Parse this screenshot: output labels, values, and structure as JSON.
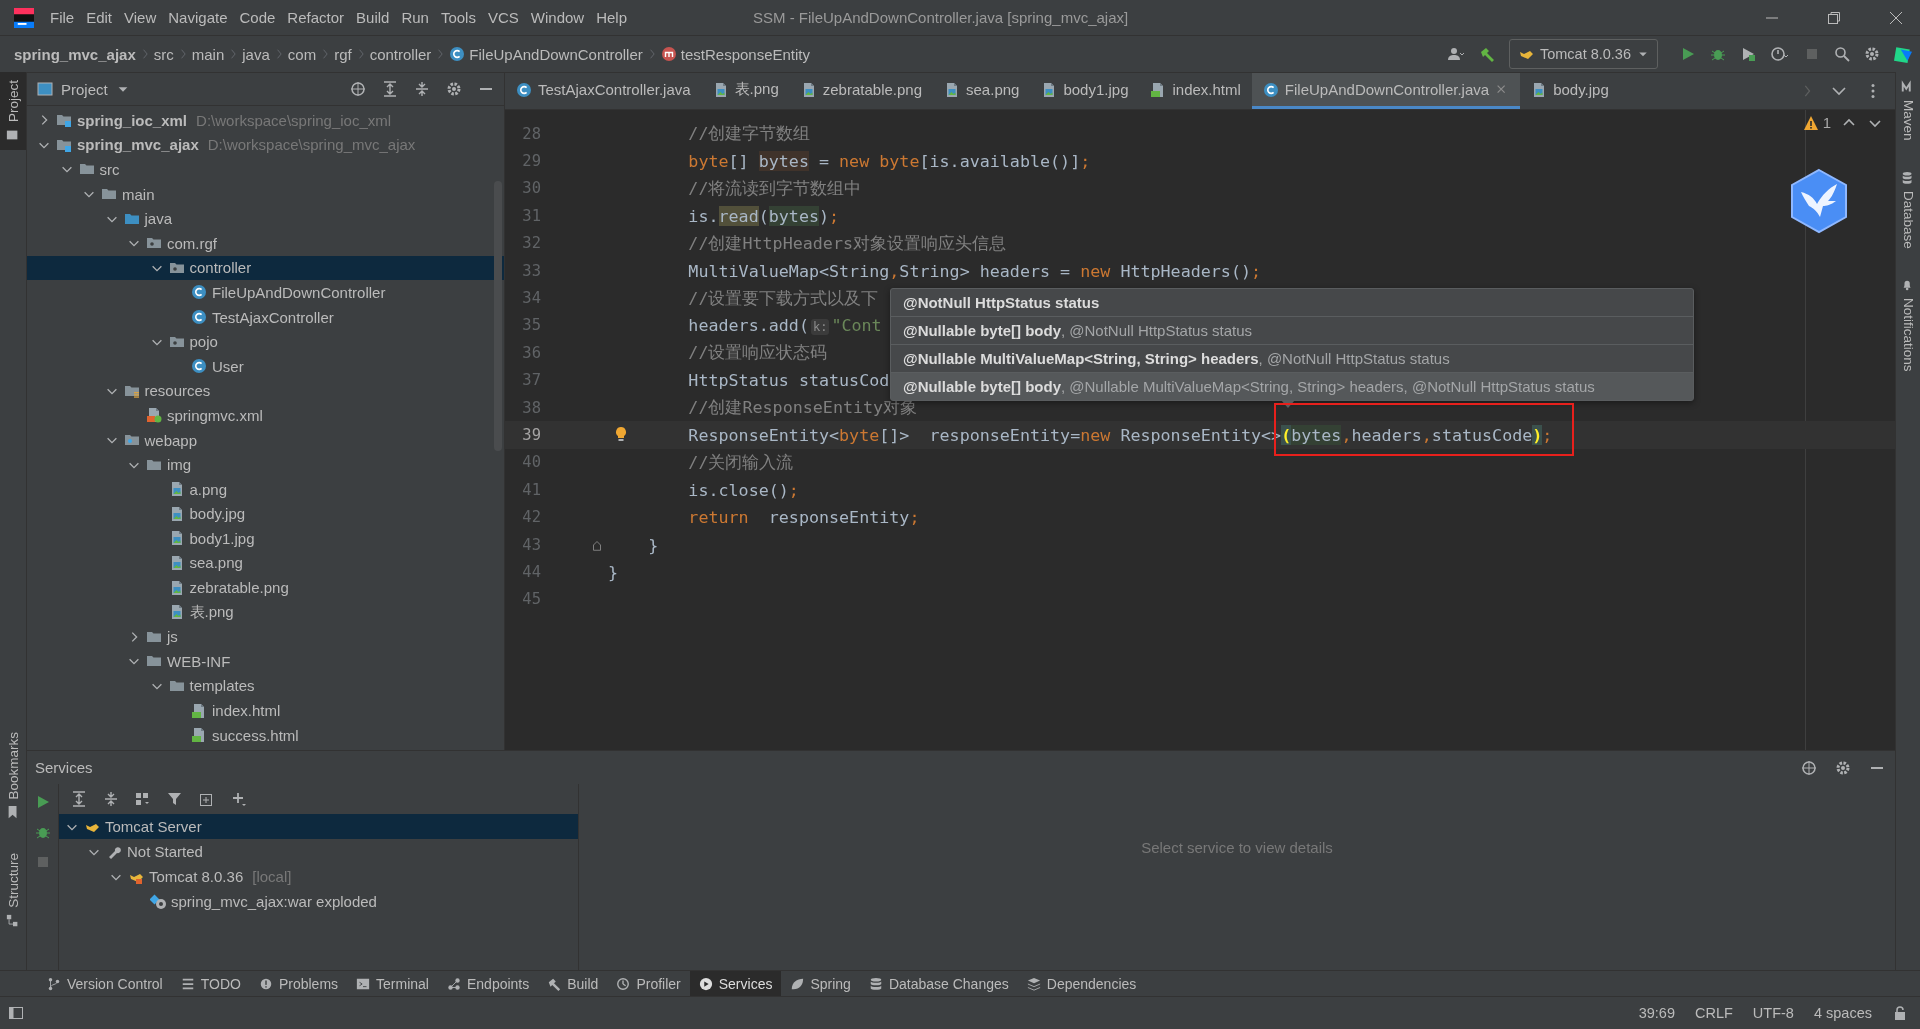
{
  "window": {
    "title": "SSM - FileUpAndDownController.java [spring_mvc_ajax]"
  },
  "menu": [
    "File",
    "Edit",
    "View",
    "Navigate",
    "Code",
    "Refactor",
    "Build",
    "Run",
    "Tools",
    "VCS",
    "Window",
    "Help"
  ],
  "navigation_bar": {
    "breadcrumbs": [
      {
        "label": "spring_mvc_ajax",
        "kind": "project"
      },
      {
        "label": "src",
        "kind": "dir"
      },
      {
        "label": "main",
        "kind": "dir"
      },
      {
        "label": "java",
        "kind": "dir"
      },
      {
        "label": "com",
        "kind": "dir"
      },
      {
        "label": "rgf",
        "kind": "dir"
      },
      {
        "label": "controller",
        "kind": "dir"
      },
      {
        "label": "FileUpAndDownController",
        "kind": "class"
      },
      {
        "label": "testResponseEntity",
        "kind": "method"
      }
    ],
    "run_configuration": "Tomcat 8.0.36"
  },
  "left_stripe": {
    "top": [
      {
        "label": "Project",
        "kind": "project",
        "selected": true
      }
    ],
    "bottom": [
      {
        "label": "Bookmarks",
        "kind": "bookmark",
        "selected": false
      },
      {
        "label": "Structure",
        "kind": "structure",
        "selected": false
      }
    ]
  },
  "project_panel": {
    "title": "Project",
    "tree": [
      {
        "label": "spring_ioc_xml",
        "hint": "D:\\workspace\\spring_ioc_xml",
        "kind": "module",
        "expanded": false,
        "selected": false
      },
      {
        "label": "spring_mvc_ajax",
        "hint": "D:\\workspace\\spring_mvc_ajax",
        "kind": "module",
        "expanded": true,
        "selected": false,
        "children": [
          {
            "label": "src",
            "kind": "folder",
            "expanded": true,
            "selected": false,
            "children": [
              {
                "label": "main",
                "kind": "folder",
                "expanded": true,
                "selected": false,
                "children": [
                  {
                    "label": "java",
                    "kind": "source",
                    "expanded": true,
                    "selected": false,
                    "children": [
                      {
                        "label": "com.rgf",
                        "kind": "package",
                        "expanded": true,
                        "selected": false,
                        "children": [
                          {
                            "label": "controller",
                            "kind": "package",
                            "expanded": true,
                            "selected": true,
                            "children": [
                              {
                                "label": "FileUpAndDownController",
                                "kind": "class",
                                "selected": false
                              },
                              {
                                "label": "TestAjaxController",
                                "kind": "class",
                                "selected": false
                              }
                            ]
                          },
                          {
                            "label": "pojo",
                            "kind": "package",
                            "expanded": true,
                            "selected": false,
                            "children": [
                              {
                                "label": "User",
                                "kind": "class",
                                "selected": false
                              }
                            ]
                          }
                        ]
                      }
                    ]
                  },
                  {
                    "label": "resources",
                    "kind": "resources",
                    "expanded": true,
                    "selected": false,
                    "children": [
                      {
                        "label": "springmvc.xml",
                        "kind": "spring_xml",
                        "selected": false
                      }
                    ]
                  },
                  {
                    "label": "webapp",
                    "kind": "web",
                    "expanded": true,
                    "selected": false,
                    "children": [
                      {
                        "label": "img",
                        "kind": "folder",
                        "expanded": true,
                        "selected": false,
                        "children": [
                          {
                            "label": "a.png",
                            "kind": "image",
                            "selected": false
                          },
                          {
                            "label": "body.jpg",
                            "kind": "image",
                            "selected": false
                          },
                          {
                            "label": "body1.jpg",
                            "kind": "image",
                            "selected": false
                          },
                          {
                            "label": "sea.png",
                            "kind": "image",
                            "selected": false
                          },
                          {
                            "label": "zebratable.png",
                            "kind": "image",
                            "selected": false
                          },
                          {
                            "label": "表.png",
                            "kind": "image",
                            "selected": false
                          }
                        ]
                      },
                      {
                        "label": "js",
                        "kind": "folder",
                        "expanded": false,
                        "selected": false
                      },
                      {
                        "label": "WEB-INF",
                        "kind": "folder",
                        "expanded": true,
                        "selected": false,
                        "children": [
                          {
                            "label": "templates",
                            "kind": "folder",
                            "expanded": true,
                            "selected": false,
                            "children": [
                              {
                                "label": "index.html",
                                "kind": "html",
                                "selected": false
                              },
                              {
                                "label": "success.html",
                                "kind": "html",
                                "selected": false
                              }
                            ]
                          }
                        ]
                      }
                    ]
                  }
                ]
              }
            ]
          }
        ]
      }
    ]
  },
  "editor": {
    "tabs": [
      {
        "label": "TestAjaxController.java",
        "kind": "class",
        "selected": false
      },
      {
        "label": "表.png",
        "kind": "image",
        "selected": false
      },
      {
        "label": "zebratable.png",
        "kind": "image",
        "selected": false
      },
      {
        "label": "sea.png",
        "kind": "image",
        "selected": false
      },
      {
        "label": "body1.jpg",
        "kind": "image",
        "selected": false
      },
      {
        "label": "index.html",
        "kind": "html",
        "selected": false
      },
      {
        "label": "FileUpAndDownController.java",
        "kind": "class",
        "selected": true
      },
      {
        "label": "body.jpg",
        "kind": "image",
        "selected": false
      }
    ],
    "warning_count": "1",
    "lines": [
      {
        "number": "28",
        "tokens": [
          {
            "text": "        //创建字节数组",
            "kind": "comment"
          }
        ]
      },
      {
        "number": "29",
        "tokens": [
          {
            "text": "        byte",
            "kind": "keyword"
          },
          {
            "text": "[] ",
            "kind": "plain"
          },
          {
            "text": "bytes",
            "kind": "write_usage"
          },
          {
            "text": " = ",
            "kind": "plain"
          },
          {
            "text": "new byte",
            "kind": "keyword"
          },
          {
            "text": "[is.available()]",
            "kind": "plain"
          },
          {
            "text": ";",
            "kind": "keyword"
          }
        ]
      },
      {
        "number": "30",
        "tokens": [
          {
            "text": "        //将流读到字节数组中",
            "kind": "comment"
          }
        ]
      },
      {
        "number": "31",
        "tokens": [
          {
            "text": "        is.",
            "kind": "plain"
          },
          {
            "text": "read",
            "kind": "usage"
          },
          {
            "text": "(",
            "kind": "plain"
          },
          {
            "text": "bytes",
            "kind": "read_usage"
          },
          {
            "text": ")",
            "kind": "plain"
          },
          {
            "text": ";",
            "kind": "keyword"
          }
        ]
      },
      {
        "number": "32",
        "tokens": [
          {
            "text": "        //创建HttpHeaders对象设置响应头信息",
            "kind": "comment"
          }
        ]
      },
      {
        "number": "33",
        "tokens": [
          {
            "text": "        MultiValueMap<String",
            "kind": "plain"
          },
          {
            "text": ",",
            "kind": "keyword"
          },
          {
            "text": "String> headers = ",
            "kind": "plain"
          },
          {
            "text": "new",
            "kind": "keyword"
          },
          {
            "text": " HttpHeaders()",
            "kind": "plain"
          },
          {
            "text": ";",
            "kind": "keyword"
          }
        ]
      },
      {
        "number": "34",
        "tokens": [
          {
            "text": "        //设置要下载方式以及下",
            "kind": "comment"
          }
        ]
      },
      {
        "number": "35",
        "tokens": [
          {
            "text": "        headers.add(",
            "kind": "plain"
          },
          {
            "text": "k:",
            "kind": "hint"
          },
          {
            "text": "\"Cont",
            "kind": "string"
          }
        ]
      },
      {
        "number": "36",
        "tokens": [
          {
            "text": "        //设置响应状态码",
            "kind": "comment"
          }
        ]
      },
      {
        "number": "37",
        "tokens": [
          {
            "text": "        HttpStatus statusCod",
            "kind": "plain"
          }
        ]
      },
      {
        "number": "38",
        "tokens": [
          {
            "text": "        //创建ResponseEntity对象",
            "kind": "comment"
          }
        ]
      },
      {
        "number": "39",
        "current": true,
        "bulb": true,
        "tokens": [
          {
            "text": "        ResponseEntity<",
            "kind": "plain"
          },
          {
            "text": "byte",
            "kind": "keyword"
          },
          {
            "text": "[]>  responseEntity=",
            "kind": "plain"
          },
          {
            "text": "new",
            "kind": "keyword"
          },
          {
            "text": " ResponseEntity<>",
            "kind": "plain"
          },
          {
            "text": "(",
            "kind": "brace_match"
          },
          {
            "text": "bytes",
            "kind": "read_usage"
          },
          {
            "text": ",",
            "kind": "keyword"
          },
          {
            "text": "headers",
            "kind": "plain"
          },
          {
            "text": ",",
            "kind": "keyword"
          },
          {
            "text": "statusCode",
            "kind": "plain"
          },
          {
            "text": ")",
            "kind": "brace_match"
          },
          {
            "text": ";",
            "kind": "keyword"
          }
        ]
      },
      {
        "number": "40",
        "tokens": [
          {
            "text": "        //关闭输入流",
            "kind": "comment"
          }
        ]
      },
      {
        "number": "41",
        "tokens": [
          {
            "text": "        is.close()",
            "kind": "plain"
          },
          {
            "text": ";",
            "kind": "keyword"
          }
        ]
      },
      {
        "number": "42",
        "tokens": [
          {
            "text": "        return",
            "kind": "keyword"
          },
          {
            "text": "  responseEntity",
            "kind": "plain"
          },
          {
            "text": ";",
            "kind": "keyword"
          }
        ]
      },
      {
        "number": "43",
        "fold": true,
        "tokens": [
          {
            "text": "    }",
            "kind": "plain"
          }
        ]
      },
      {
        "number": "44",
        "tokens": [
          {
            "text": "}",
            "kind": "plain"
          }
        ]
      },
      {
        "number": "45"
      }
    ],
    "parameter_info": [
      {
        "bold": "@NotNull HttpStatus status",
        "selected": false
      },
      {
        "bold": "@Nullable byte[] body",
        "rest": ", @NotNull HttpStatus status",
        "selected": false
      },
      {
        "bold": "@Nullable MultiValueMap<String, String> headers",
        "rest": ", @NotNull HttpStatus status",
        "selected": false
      },
      {
        "bold": "@Nullable byte[] body",
        "rest": ", @Nullable MultiValueMap<String, String> headers, @NotNull HttpStatus status",
        "selected": true
      }
    ]
  },
  "right_stripe": [
    {
      "label": "Maven",
      "kind": "maven"
    },
    {
      "label": "Database",
      "kind": "database"
    },
    {
      "label": "Notifications",
      "kind": "bell"
    }
  ],
  "services": {
    "title": "Services",
    "tree": [
      {
        "label": "Tomcat Server",
        "kind": "tomcat",
        "expanded": true,
        "selected": true,
        "children": [
          {
            "label": "Not Started",
            "kind": "wrench",
            "expanded": true,
            "selected": false,
            "children": [
              {
                "label": "Tomcat 8.0.36",
                "hint": "[local]",
                "kind": "tomcat_local",
                "expanded": true,
                "selected": false,
                "children": [
                  {
                    "label": "spring_mvc_ajax:war exploded",
                    "kind": "artifact",
                    "selected": false
                  }
                ]
              }
            ]
          }
        ]
      }
    ],
    "empty_text": "Select service to view details"
  },
  "tool_tabs": [
    {
      "label": "Version Control",
      "kind": "vcs",
      "selected": false
    },
    {
      "label": "TODO",
      "kind": "todo",
      "selected": false
    },
    {
      "label": "Problems",
      "kind": "problems",
      "selected": false
    },
    {
      "label": "Terminal",
      "kind": "terminal",
      "selected": false
    },
    {
      "label": "Endpoints",
      "kind": "endpoints",
      "selected": false
    },
    {
      "label": "Build",
      "kind": "build",
      "selected": false
    },
    {
      "label": "Profiler",
      "kind": "profiler",
      "selected": false
    },
    {
      "label": "Services",
      "kind": "services",
      "selected": true
    },
    {
      "label": "Spring",
      "kind": "spring",
      "selected": false
    },
    {
      "label": "Database Changes",
      "kind": "database",
      "selected": false
    },
    {
      "label": "Dependencies",
      "kind": "dependencies",
      "selected": false
    }
  ],
  "status_bar": [
    "39:69",
    "CRLF",
    "UTF-8",
    "4 spaces"
  ]
}
